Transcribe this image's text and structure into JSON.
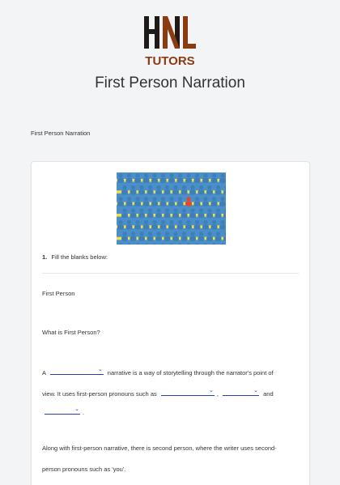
{
  "brand": {
    "logo_letters": "HNL",
    "logo_tagline": "TUTORS",
    "colors": {
      "dark": "#1f1a17",
      "rust": "#8a3b12"
    }
  },
  "page_title": "First Person Narration",
  "form_subtitle": "First Person Narration",
  "question": {
    "number": "1.",
    "prompt": "Fill the blanks below:",
    "section_title": "First Person",
    "subheading": "What is First Person?",
    "para1": {
      "start": "A",
      "after_blank1": "narrative is a way of storytelling through the narrator's point of",
      "line2_start": "view. It uses first-person pronouns such as",
      "separator": ",",
      "conjunction": "and",
      "end": "."
    },
    "para2": {
      "line1": "Along with first-person narrative, there is second person, where the writer uses second-",
      "line2": "person pronouns such as 'you'."
    }
  },
  "dropdown_icon": "chevron-down-icon",
  "accent_color": "#2c3fa8"
}
